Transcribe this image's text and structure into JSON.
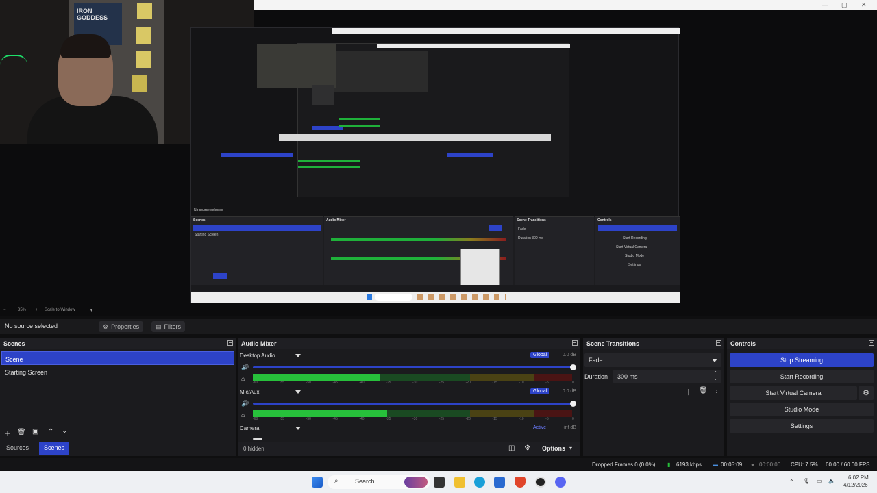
{
  "nested_preview": {
    "webcam_poster_text": "IRON GODDESS",
    "zoom_label": "35%",
    "scale_label": "Scale to Window"
  },
  "source_toolbar": {
    "no_source": "No source selected",
    "properties_label": "Properties",
    "filters_label": "Filters"
  },
  "scenes": {
    "title": "Scenes",
    "items": [
      {
        "label": "Scene",
        "selected": true
      },
      {
        "label": "Starting Screen",
        "selected": false
      }
    ],
    "tabs": [
      {
        "label": "Sources",
        "active": false
      },
      {
        "label": "Scenes",
        "active": true
      }
    ]
  },
  "audio_mixer": {
    "title": "Audio Mixer",
    "channels": [
      {
        "name": "Desktop Audio",
        "badge": "Global",
        "db": "0.0 dB",
        "level": 0.4
      },
      {
        "name": "Mic/Aux",
        "badge": "Global",
        "db": "0.0 dB",
        "level": 0.42
      },
      {
        "name": "Camera",
        "badge": "Active",
        "db": "-inf dB",
        "level": 0
      }
    ],
    "ticks": [
      "-60",
      "-55",
      "-50",
      "-45",
      "-40",
      "-35",
      "-30",
      "-25",
      "-20",
      "-15",
      "-10",
      "-5",
      "0"
    ],
    "hidden_label": "0 hidden",
    "options_label": "Options"
  },
  "scene_transitions": {
    "title": "Scene Transitions",
    "transition": "Fade",
    "duration_label": "Duration",
    "duration_value": "300 ms"
  },
  "controls": {
    "title": "Controls",
    "buttons": [
      {
        "label": "Stop Streaming",
        "primary": true
      },
      {
        "label": "Start Recording",
        "primary": false
      },
      {
        "label": "Start Virtual Camera",
        "primary": false
      },
      {
        "label": "Studio Mode",
        "primary": false
      },
      {
        "label": "Settings",
        "primary": false
      }
    ]
  },
  "status": {
    "dropped_frames": "Dropped Frames 0 (0.0%)",
    "bitrate": "6193 kbps",
    "stream_time": "00:05:09",
    "rec_time": "00:00:00",
    "cpu": "CPU: 7.5%",
    "fps": "60.00 / 60.00 FPS"
  },
  "taskbar": {
    "search_label": "Search",
    "time": "6:02 PM",
    "date": "4/12/2026"
  },
  "colors": {
    "accent": "#2d43c8",
    "meter_green": "#27c03b",
    "panel": "#1b1b1e"
  }
}
